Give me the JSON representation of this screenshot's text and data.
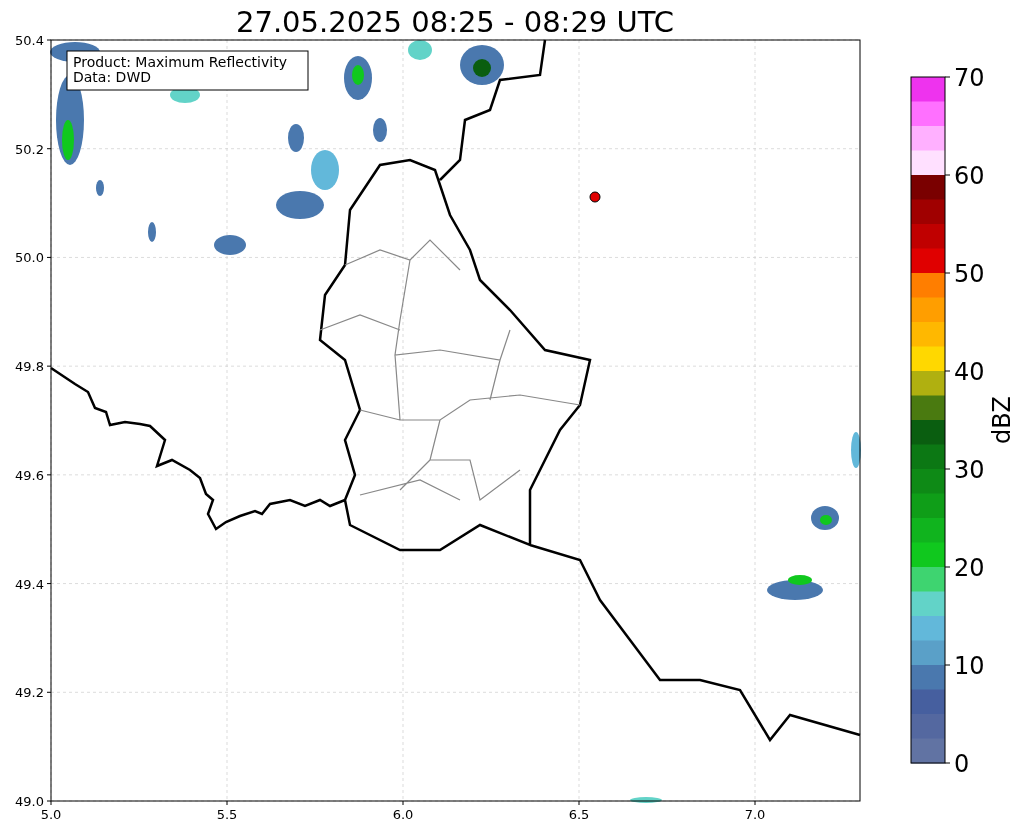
{
  "title": "27.05.2025 08:25 - 08:29 UTC",
  "legend": [
    "Product: Maximum Reflectivity",
    "Data: DWD"
  ],
  "x_ticks": [
    "5.0",
    "5.5",
    "6.0",
    "6.5",
    "7.0"
  ],
  "y_ticks": [
    "50.4",
    "50.2",
    "50.0",
    "49.8",
    "49.6",
    "49.4",
    "49.2",
    "49.0"
  ],
  "colorbar": {
    "label": "dBZ",
    "ticks": [
      "70",
      "60",
      "50",
      "40",
      "30",
      "20",
      "10",
      "0"
    ],
    "segments": [
      {
        "color": "#ee33ee"
      },
      {
        "color": "#ff70ff"
      },
      {
        "color": "#ffb0ff"
      },
      {
        "color": "#ffe0ff"
      },
      {
        "color": "#7a0000"
      },
      {
        "color": "#a00000"
      },
      {
        "color": "#c00000"
      },
      {
        "color": "#e00000"
      },
      {
        "color": "#ff7e00"
      },
      {
        "color": "#ff9e00"
      },
      {
        "color": "#ffb800"
      },
      {
        "color": "#ffd800"
      },
      {
        "color": "#b0b010"
      },
      {
        "color": "#4a7a10"
      },
      {
        "color": "#0a5e10"
      },
      {
        "color": "#0c7814"
      },
      {
        "color": "#0e8a16"
      },
      {
        "color": "#0f9e18"
      },
      {
        "color": "#10b41e"
      },
      {
        "color": "#10c81e"
      },
      {
        "color": "#3ed470"
      },
      {
        "color": "#62d3c8"
      },
      {
        "color": "#62b8da"
      },
      {
        "color": "#5aa0c8"
      },
      {
        "color": "#4a78ae"
      },
      {
        "color": "#465f9f"
      },
      {
        "color": "#5468a0"
      },
      {
        "color": "#6173a3"
      }
    ]
  }
}
